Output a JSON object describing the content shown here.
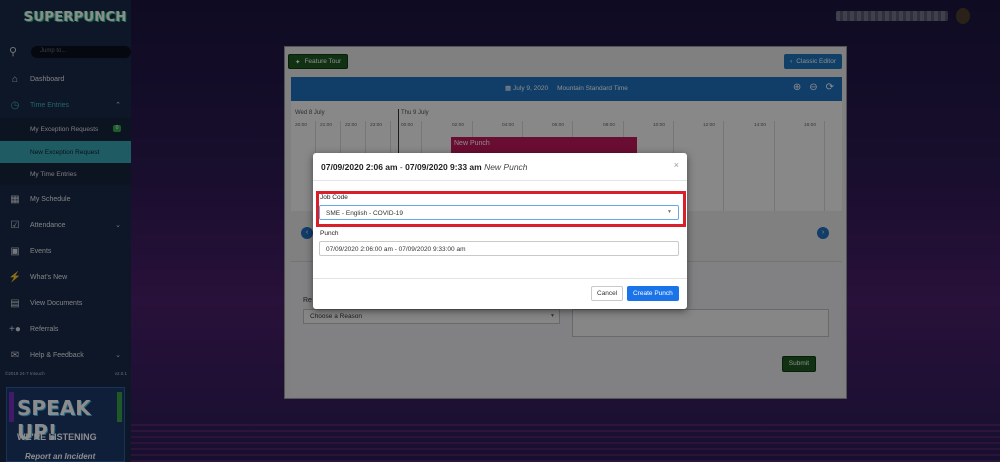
{
  "app": {
    "logo": "SUPERPUNCH"
  },
  "search": {
    "placeholder": "Jump to..."
  },
  "sidebar": {
    "items": [
      {
        "label": "Dashboard",
        "icon": "home-icon"
      },
      {
        "label": "Time Entries",
        "icon": "clock-icon"
      },
      {
        "label": "My Schedule",
        "icon": "calendar-icon"
      },
      {
        "label": "Attendance",
        "icon": "calendar-check-icon"
      },
      {
        "label": "Events",
        "icon": "events-icon"
      },
      {
        "label": "What's New",
        "icon": "bolt-icon"
      },
      {
        "label": "View Documents",
        "icon": "document-icon"
      },
      {
        "label": "Referrals",
        "icon": "add-user-icon"
      },
      {
        "label": "Help & Feedback",
        "icon": "chat-icon"
      }
    ],
    "sub_items": [
      {
        "label": "My Exception Requests",
        "badge": "0"
      },
      {
        "label": "New Exception Request"
      },
      {
        "label": "My Time Entries"
      }
    ],
    "footer": {
      "copyright": "©2019 24-7 Intouch",
      "version": "v2.0.1"
    },
    "banner": {
      "title": "SPEAK UP!",
      "subtitle": "WE'RE LISTENING",
      "cta": "Report an Incident"
    }
  },
  "toolbar": {
    "feature_tour": "Feature Tour",
    "classic_editor": "Classic Editor"
  },
  "calendar": {
    "date": "July 9, 2020",
    "timezone": "Mountain Standard Time",
    "day1": "Wed 8 July",
    "day2": "Thu 9 July",
    "hours": [
      "20:00",
      "21:00",
      "22:00",
      "23:00",
      "00:00",
      "02:00",
      "04:00",
      "06:00",
      "08:00",
      "10:00",
      "12:00",
      "14:00",
      "16:00"
    ],
    "punch_label": "New Punch"
  },
  "form": {
    "reason_label": "Re",
    "reason_placeholder": "Choose a Reason",
    "submit": "Submit"
  },
  "modal": {
    "start": "07/09/2020 2:06 am",
    "separator": " - ",
    "end": "07/09/2020 9:33 am",
    "subtitle": "New Punch",
    "close": "×",
    "job_code_label": "Job Code",
    "job_code_value": "SME - English - COVID-19",
    "punch_label": "Punch",
    "punch_value": "07/09/2020 2:06:00 am - 07/09/2020 9:33:00 am",
    "cancel": "Cancel",
    "create": "Create Punch"
  },
  "colors": {
    "sidebar": "#1b2a47",
    "accent": "#1f6fc0",
    "highlight": "#d9202a",
    "punch": "#c2185b"
  }
}
